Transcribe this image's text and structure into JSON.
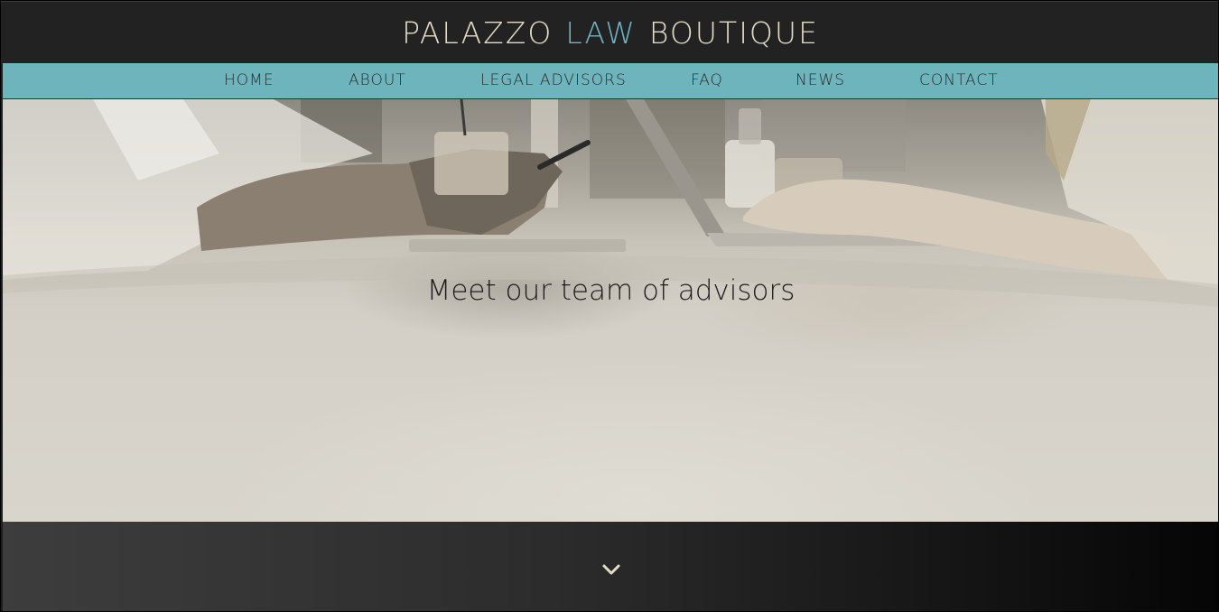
{
  "brand": {
    "part1": "PALAZZO",
    "part2": "LAW",
    "part3": "BOUTIQUE"
  },
  "nav": {
    "items": [
      {
        "label": "HOME"
      },
      {
        "label": "ABOUT"
      },
      {
        "label": "LEGAL ADVISORS"
      },
      {
        "label": "FAQ"
      },
      {
        "label": "NEWS"
      },
      {
        "label": "CONTACT"
      }
    ]
  },
  "hero": {
    "title": "Meet our team of advisors"
  },
  "scroll": {
    "icon": "chevron-down-icon"
  },
  "colors": {
    "header_bg": "#222222",
    "nav_bg": "#6eb4bd",
    "brand_text": "#e4dcc4",
    "brand_accent": "#6fb3c4",
    "chevron": "#e4dcc4"
  }
}
